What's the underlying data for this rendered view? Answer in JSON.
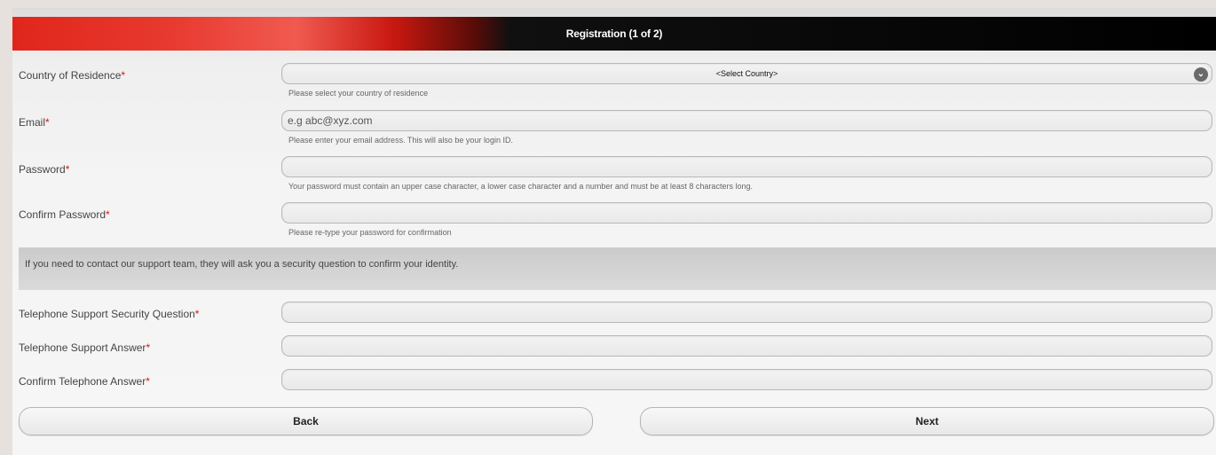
{
  "header": {
    "title": "Registration (1 of 2)"
  },
  "required_marker": "*",
  "fields": {
    "country": {
      "label": "Country of Residence",
      "value": "<Select Country>",
      "hint": "Please select your country of residence"
    },
    "email": {
      "label": "Email",
      "placeholder": "e.g abc@xyz.com",
      "hint": "Please enter your email address. This will also be your login ID."
    },
    "password": {
      "label": "Password",
      "hint": "Your password must contain an upper case character, a lower case character and a number and must be at least 8 characters long."
    },
    "confirm_password": {
      "label": "Confirm Password",
      "hint": "Please re-type your password for confirmation"
    },
    "security_question": {
      "label": "Telephone Support Security Question"
    },
    "support_answer": {
      "label": "Telephone Support Answer"
    },
    "confirm_answer": {
      "label": "Confirm Telephone Answer"
    }
  },
  "info_text": "If you need to contact our support team, they will ask you a security question to confirm your identity.",
  "buttons": {
    "back": "Back",
    "next": "Next"
  },
  "icons": {
    "select_chevron": "chevron-down-icon"
  },
  "colors": {
    "required": "#e01010",
    "header_red": "#e0261c",
    "header_black": "#000000"
  }
}
